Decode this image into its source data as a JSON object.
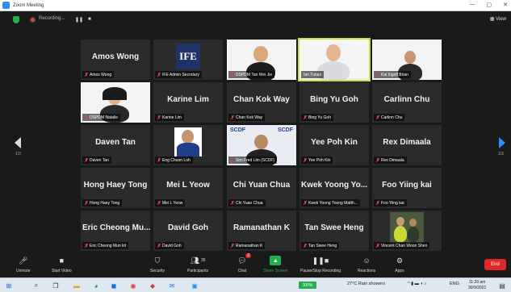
{
  "window": {
    "title": "Zoom Meeting",
    "controls": [
      "—",
      "▢",
      "✕"
    ]
  },
  "meeting_bar": {
    "recording_label": "Recording...",
    "view_label": "View"
  },
  "pagination": {
    "left": "1/3",
    "right": "1/3"
  },
  "tiles": [
    {
      "big": "Amos Wong",
      "label": "Amos Wong"
    },
    {
      "big": "",
      "label": "IFE Admin Secretary"
    },
    {
      "big": "",
      "label": "DSPDM Tan Wei Jie"
    },
    {
      "big": "",
      "label": "Ian Tunan"
    },
    {
      "big": "",
      "label": "Kai Ingolf Brian"
    },
    {
      "big": "",
      "label": "DSPDM Natalie"
    },
    {
      "big": "Karine Lim",
      "label": "Karine Lim"
    },
    {
      "big": "Chan Kok Way",
      "label": "Chan Kok Way"
    },
    {
      "big": "Bing Yu Goh",
      "label": "Bing Yu Goh"
    },
    {
      "big": "Carlinn Chu",
      "label": "Carlinn Chu"
    },
    {
      "big": "Daven Tan",
      "label": "Daven Tan"
    },
    {
      "big": "",
      "label": "Eng Chuon Loh"
    },
    {
      "big": "",
      "label": "Sim Fred Lim (SCDF)"
    },
    {
      "big": "Yee Poh Kin",
      "label": "Yee Poh Kin"
    },
    {
      "big": "Rex Dimaala",
      "label": "Rex Dimaala"
    },
    {
      "big": "Hong Haey Tong",
      "label": "Hong Haey Tong"
    },
    {
      "big": "Mei L Yeow",
      "label": "Mei L Yeow"
    },
    {
      "big": "Chi Yuan Chua",
      "label": "Chi Yuan Chua"
    },
    {
      "big": "Kwek Yoong Yo...",
      "label": "Kwek Yoong Yoong Matth..."
    },
    {
      "big": "Foo Yiing kai",
      "label": "Foo Yiing kai"
    },
    {
      "big": "Eric Cheong Mu...",
      "label": "Eric Cheong Mun kit"
    },
    {
      "big": "David Goh",
      "label": "David Goh"
    },
    {
      "big": "Ramanathan K",
      "label": "Ramanathan K"
    },
    {
      "big": "Tan Swee Heng",
      "label": "Tan Swee Heng"
    },
    {
      "big": "",
      "label": "Vincent Chan Woon Shen"
    }
  ],
  "toolbar": {
    "unmute": "Unmute",
    "start_video": "Start Video",
    "security": "Security",
    "participants": "Participants",
    "participants_count": "35",
    "chat": "Chat",
    "chat_badge": "2",
    "share_screen": "Share Screen",
    "pause_recording": "Pause/Stop Recording",
    "reactions": "Reactions",
    "apps": "Apps",
    "end": "End"
  },
  "taskbar": {
    "battery": "100%",
    "weather": "27°C  Rain showers",
    "lang": "ENG",
    "time": "11:29 am",
    "date": "30/9/2021"
  },
  "colors": {
    "accent": "#2d8cff",
    "end": "#e02828",
    "active_speaker": "#c6e03c",
    "green": "#23b14d"
  }
}
